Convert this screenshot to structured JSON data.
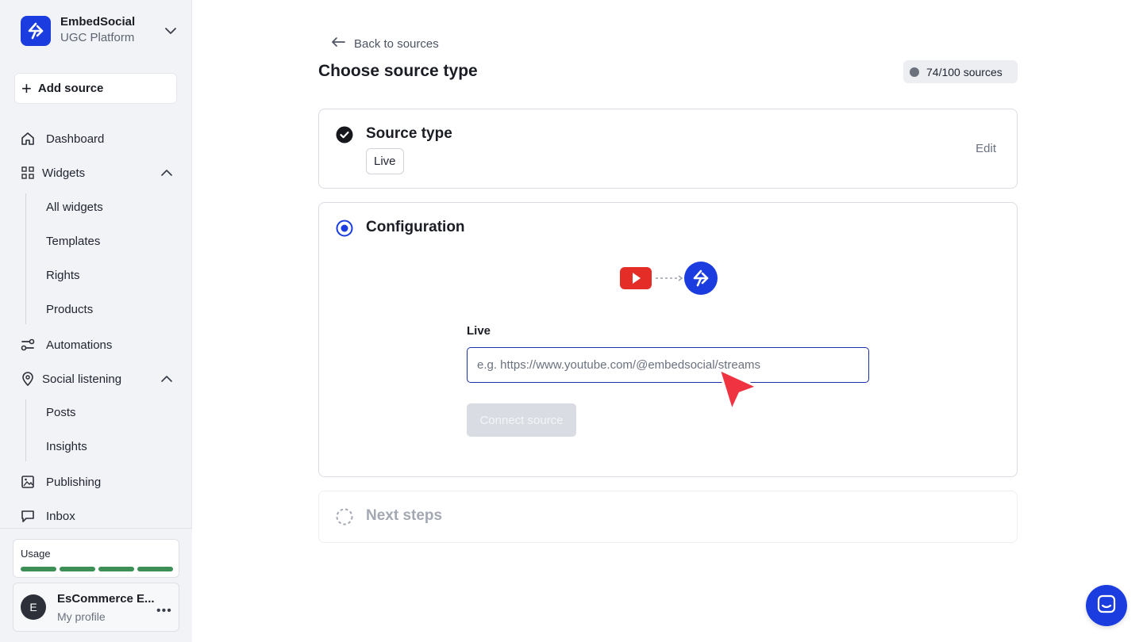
{
  "brand": {
    "name": "EmbedSocial",
    "subtitle": "UGC Platform"
  },
  "sidebar": {
    "add_source_label": "Add source",
    "dashboard": "Dashboard",
    "widgets": {
      "label": "Widgets",
      "items": [
        "All widgets",
        "Templates",
        "Rights",
        "Products"
      ]
    },
    "automations": "Automations",
    "social_listening": {
      "label": "Social listening",
      "items": [
        "Posts",
        "Insights"
      ]
    },
    "publishing": "Publishing",
    "inbox": "Inbox",
    "usage_label": "Usage",
    "usage_segments_filled": 4,
    "profile": {
      "initial": "E",
      "name": "EsCommerce E...",
      "subtitle": "My profile"
    }
  },
  "main": {
    "back_label": "Back to sources",
    "title": "Choose source type",
    "quota": "74/100 sources",
    "source_type": {
      "title": "Source type",
      "chip": "Live",
      "edit_label": "Edit"
    },
    "configuration": {
      "title": "Configuration",
      "field_label": "Live",
      "input_value": "",
      "input_placeholder": "e.g. https://www.youtube.com/@embedsocial/streams",
      "connect_label": "Connect source"
    },
    "next_steps": {
      "title": "Next steps"
    }
  },
  "colors": {
    "brand_blue": "#1b3de0",
    "youtube_red": "#e52d27",
    "usage_green": "#3c8f55",
    "cursor_red": "#ef3340"
  },
  "icons": [
    "chevron-down-icon",
    "plus-icon",
    "home-icon",
    "grid-icon",
    "automations-icon",
    "location-pin-icon",
    "image-icon",
    "chat-icon",
    "arrow-left-icon",
    "check-circle-icon",
    "radio-active-icon",
    "dashed-circle-icon",
    "youtube-icon",
    "embedsocial-logo-icon",
    "cursor-icon",
    "messenger-icon"
  ]
}
